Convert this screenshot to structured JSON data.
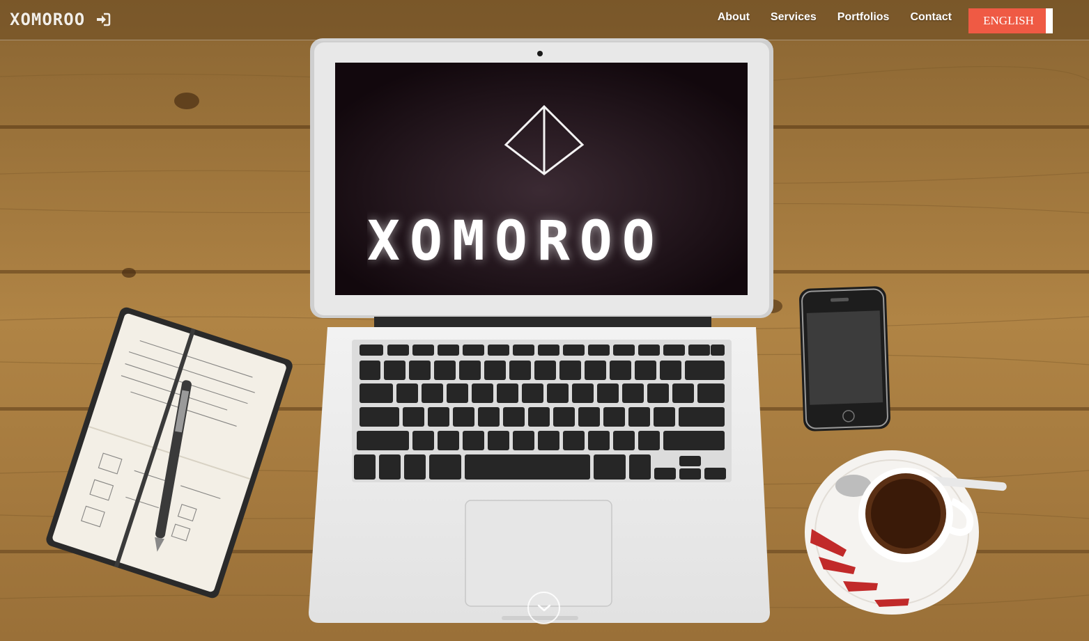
{
  "navbar": {
    "brand": "XOMOROO",
    "login_icon": "sign-in-icon",
    "links": [
      "About",
      "Services",
      "Portfolios",
      "Contact"
    ],
    "language_button": "ENGLISH"
  },
  "hero": {
    "screen_logo_text": "XOMOROO",
    "scroll_icon": "chevron-down-icon"
  },
  "colors": {
    "accent": "#ef5a44",
    "wood": "#a77b3f",
    "screen": "#1b0f15"
  }
}
